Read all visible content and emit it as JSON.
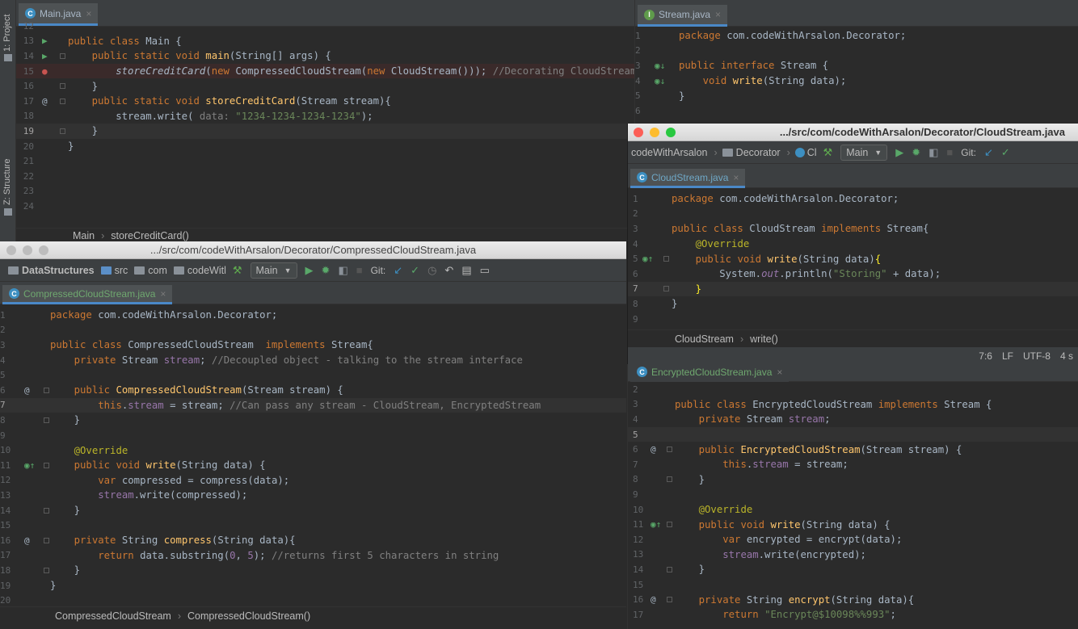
{
  "sidebar": {
    "project_label": "1: Project",
    "structure_label": "Z: Structure"
  },
  "main_pane": {
    "tab": "Main.java",
    "lines": [
      {
        "n": "12",
        "html": ""
      },
      {
        "n": "13",
        "html": "<span class='kw'>public class </span>Main {"
      },
      {
        "n": "14",
        "html": "    <span class='kw'>public static void </span><span class='fn'>main</span>(String[] args) {"
      },
      {
        "n": "15",
        "html": "        <span class='it'>storeCreditCard</span>(<span class='kw'>new </span>CompressedCloudStream(<span class='kw'>new </span>CloudStream())); <span class='cm'>//Decorating CloudStream</span>"
      },
      {
        "n": "16",
        "html": "    }"
      },
      {
        "n": "17",
        "html": "    <span class='kw'>public static void </span><span class='fn'>storeCreditCard</span>(Stream stream){"
      },
      {
        "n": "18",
        "html": "        stream.write( <span class='cm'>data: </span><span class='st'>\"1234-1234-1234-1234\"</span>);"
      },
      {
        "n": "19",
        "html": "    }"
      },
      {
        "n": "20",
        "html": "}"
      },
      {
        "n": "21",
        "html": ""
      },
      {
        "n": "22",
        "html": ""
      },
      {
        "n": "23",
        "html": ""
      },
      {
        "n": "24",
        "html": ""
      }
    ],
    "breadcrumb": [
      "Main",
      "storeCreditCard()"
    ]
  },
  "stream_pane": {
    "tab": "Stream.java",
    "lines": [
      {
        "n": "1",
        "html": "<span class='kw'>package </span>com.codeWithArsalon.Decorator;"
      },
      {
        "n": "2",
        "html": ""
      },
      {
        "n": "3",
        "html": "<span class='kw'>public interface </span>Stream {"
      },
      {
        "n": "4",
        "html": "    <span class='kw'>void </span><span class='fn'>write</span>(String data);"
      },
      {
        "n": "5",
        "html": "}"
      },
      {
        "n": "6",
        "html": ""
      }
    ]
  },
  "compressed_window": {
    "title": ".../src/com/codeWithArsalon/Decorator/CompressedCloudStream.java",
    "nav": {
      "project": "DataStructures",
      "src": "src",
      "com": "com",
      "pkg": "codeWitl",
      "run_config": "Main",
      "git_label": "Git:"
    },
    "tab": "CompressedCloudStream.java",
    "lines": [
      {
        "n": "1",
        "html": "<span class='kw'>package </span>com.codeWithArsalon.Decorator;"
      },
      {
        "n": "2",
        "html": ""
      },
      {
        "n": "3",
        "html": "<span class='kw'>public class </span>CompressedCloudStream  <span class='kw'>implements </span>Stream{"
      },
      {
        "n": "4",
        "html": "    <span class='kw'>private </span>Stream <span class='fd'>stream</span>; <span class='cm'>//Decoupled object - talking to the stream interface</span>"
      },
      {
        "n": "5",
        "html": ""
      },
      {
        "n": "6",
        "html": "    <span class='kw'>public </span><span class='fn'>CompressedCloudStream</span>(Stream stream) {"
      },
      {
        "n": "7",
        "html": "        <span class='kw'>this</span>.<span class='fd'>stream</span> = stream; <span class='cm'>//Can pass any stream - CloudStream, EncryptedStream</span>"
      },
      {
        "n": "8",
        "html": "    }"
      },
      {
        "n": "9",
        "html": ""
      },
      {
        "n": "10",
        "html": "    <span class='an'>@Override</span>"
      },
      {
        "n": "11",
        "html": "    <span class='kw'>public void </span><span class='fn'>write</span>(String data) {"
      },
      {
        "n": "12",
        "html": "        <span class='kw'>var </span>compressed = compress(data);"
      },
      {
        "n": "13",
        "html": "        <span class='fd'>stream</span>.write(compressed);"
      },
      {
        "n": "14",
        "html": "    }"
      },
      {
        "n": "15",
        "html": ""
      },
      {
        "n": "16",
        "html": "    <span class='kw'>private </span>String <span class='fn'>compress</span>(String data){"
      },
      {
        "n": "17",
        "html": "        <span class='kw'>return </span>data.substring(<span class='fd'>0</span>, <span class='fd'>5</span>); <span class='cm'>//returns first 5 characters in string</span>"
      },
      {
        "n": "18",
        "html": "    }"
      },
      {
        "n": "19",
        "html": "}"
      },
      {
        "n": "20",
        "html": ""
      }
    ],
    "breadcrumb": [
      "CompressedCloudStream",
      "CompressedCloudStream()"
    ]
  },
  "cloud_window": {
    "title": ".../src/com/codeWithArsalon/Decorator/CloudStream.java",
    "nav": {
      "pkg": "codeWithArsalon",
      "dir": "Decorator",
      "cls": "Cl",
      "run_config": "Main",
      "git_label": "Git:"
    },
    "tab": "CloudStream.java",
    "lines": [
      {
        "n": "1",
        "html": "<span class='kw'>package </span>com.codeWithArsalon.Decorator;"
      },
      {
        "n": "2",
        "html": ""
      },
      {
        "n": "3",
        "html": "<span class='kw'>public class </span>CloudStream <span class='kw'>implements </span>Stream{"
      },
      {
        "n": "4",
        "html": "    <span class='an'>@Override</span>"
      },
      {
        "n": "5",
        "html": "    <span class='kw'>public void </span><span class='fn'>write</span>(String data)<span style='color:#ffef28'>{</span>"
      },
      {
        "n": "6",
        "html": "        System.<span class='fd it'>out</span>.println(<span class='st'>\"Storing\"</span> + data);"
      },
      {
        "n": "7",
        "html": "    <span style='color:#ffef28'>}</span>"
      },
      {
        "n": "8",
        "html": "}"
      },
      {
        "n": "9",
        "html": ""
      }
    ],
    "breadcrumb": [
      "CloudStream",
      "write()"
    ],
    "status": {
      "pos": "7:6",
      "sep": "LF",
      "enc": "UTF-8",
      "indent": "4 s"
    }
  },
  "encrypted_pane": {
    "tab": "EncryptedCloudStream.java",
    "lines": [
      {
        "n": "2",
        "html": ""
      },
      {
        "n": "3",
        "html": "<span class='kw'>public class </span>EncryptedCloudStream <span class='kw'>implements </span>Stream {"
      },
      {
        "n": "4",
        "html": "    <span class='kw'>private </span>Stream <span class='fd'>stream</span>;"
      },
      {
        "n": "5",
        "html": ""
      },
      {
        "n": "6",
        "html": "    <span class='kw'>public </span><span class='fn'>EncryptedCloudStream</span>(Stream stream) {"
      },
      {
        "n": "7",
        "html": "        <span class='kw'>this</span>.<span class='fd'>stream</span> = stream;"
      },
      {
        "n": "8",
        "html": "    }"
      },
      {
        "n": "9",
        "html": ""
      },
      {
        "n": "10",
        "html": "    <span class='an'>@Override</span>"
      },
      {
        "n": "11",
        "html": "    <span class='kw'>public void </span><span class='fn'>write</span>(String data) {"
      },
      {
        "n": "12",
        "html": "        <span class='kw'>var </span>encrypted = encrypt(data);"
      },
      {
        "n": "13",
        "html": "        <span class='fd'>stream</span>.write(encrypted);"
      },
      {
        "n": "14",
        "html": "    }"
      },
      {
        "n": "15",
        "html": ""
      },
      {
        "n": "16",
        "html": "    <span class='kw'>private </span>String <span class='fn'>encrypt</span>(String data){"
      },
      {
        "n": "17",
        "html": "        <span class='kw'>return </span><span class='st'>\"Encrypt@$10098%%993\"</span>;"
      }
    ]
  }
}
